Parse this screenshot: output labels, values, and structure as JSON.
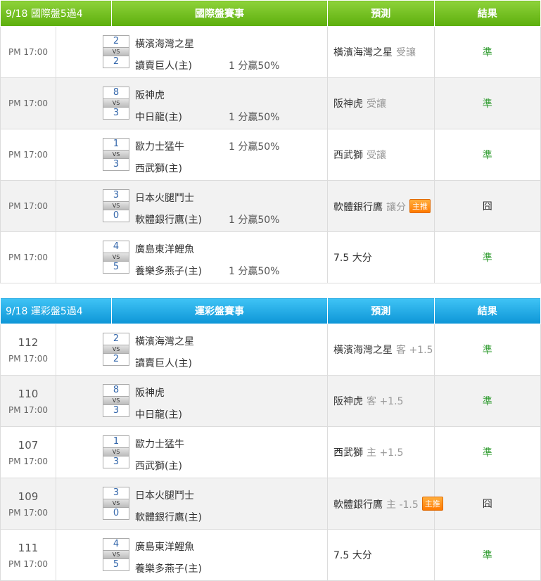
{
  "sections": [
    {
      "id": "intl",
      "title": "9/18 國際盤5過4",
      "headers": {
        "event": "國際盤賽事",
        "predict": "預測",
        "result": "結果"
      },
      "rows": [
        {
          "number": "",
          "time": "PM 17:00",
          "score_top": "2",
          "vs": "VS",
          "score_bot": "2",
          "team_top": "橫濱海灣之星",
          "team_bot": "讀賣巨人(主)",
          "odds": "1 分贏50%",
          "odds_on": "bot",
          "pred_team": "橫濱海灣之星",
          "pred_kind": "受讓",
          "badge": "",
          "result": "準"
        },
        {
          "number": "",
          "time": "PM 17:00",
          "score_top": "8",
          "vs": "VS",
          "score_bot": "3",
          "team_top": "阪神虎",
          "team_bot": "中日龍(主)",
          "odds": "1 分贏50%",
          "odds_on": "bot",
          "pred_team": "阪神虎",
          "pred_kind": "受讓",
          "badge": "",
          "result": "準"
        },
        {
          "number": "",
          "time": "PM 17:00",
          "score_top": "1",
          "vs": "VS",
          "score_bot": "3",
          "team_top": "歐力士猛牛",
          "team_bot": "西武獅(主)",
          "odds": "1 分贏50%",
          "odds_on": "top",
          "pred_team": "西武獅",
          "pred_kind": "受讓",
          "badge": "",
          "result": "準"
        },
        {
          "number": "",
          "time": "PM 17:00",
          "score_top": "3",
          "vs": "VS",
          "score_bot": "0",
          "team_top": "日本火腿鬥士",
          "team_bot": "軟體銀行鷹(主)",
          "odds": "1 分贏50%",
          "odds_on": "bot",
          "pred_team": "軟體銀行鷹",
          "pred_kind": "讓分",
          "badge": "主推",
          "result": "囧"
        },
        {
          "number": "",
          "time": "PM 17:00",
          "score_top": "4",
          "vs": "VS",
          "score_bot": "5",
          "team_top": "廣島東洋鯉魚",
          "team_bot": "養樂多燕子(主)",
          "odds": "1 分贏50%",
          "odds_on": "bot",
          "pred_team": "7.5 大分",
          "pred_kind": "",
          "badge": "",
          "result": "準"
        }
      ]
    },
    {
      "id": "lottery",
      "title": "9/18 運彩盤5過4",
      "headers": {
        "event": "運彩盤賽事",
        "predict": "預測",
        "result": "結果"
      },
      "rows": [
        {
          "number": "112",
          "time": "PM 17:00",
          "score_top": "2",
          "vs": "VS",
          "score_bot": "2",
          "team_top": "橫濱海灣之星",
          "team_bot": "讀賣巨人(主)",
          "odds": "",
          "odds_on": "",
          "pred_team": "橫濱海灣之星",
          "pred_kind": "客 +1.5",
          "badge": "",
          "result": "準"
        },
        {
          "number": "110",
          "time": "PM 17:00",
          "score_top": "8",
          "vs": "VS",
          "score_bot": "3",
          "team_top": "阪神虎",
          "team_bot": "中日龍(主)",
          "odds": "",
          "odds_on": "",
          "pred_team": "阪神虎",
          "pred_kind": "客 +1.5",
          "badge": "",
          "result": "準"
        },
        {
          "number": "107",
          "time": "PM 17:00",
          "score_top": "1",
          "vs": "VS",
          "score_bot": "3",
          "team_top": "歐力士猛牛",
          "team_bot": "西武獅(主)",
          "odds": "",
          "odds_on": "",
          "pred_team": "西武獅",
          "pred_kind": "主 +1.5",
          "badge": "",
          "result": "準"
        },
        {
          "number": "109",
          "time": "PM 17:00",
          "score_top": "3",
          "vs": "VS",
          "score_bot": "0",
          "team_top": "日本火腿鬥士",
          "team_bot": "軟體銀行鷹(主)",
          "odds": "",
          "odds_on": "",
          "pred_team": "軟體銀行鷹",
          "pred_kind": "主 -1.5",
          "badge": "主推",
          "result": "囧"
        },
        {
          "number": "111",
          "time": "PM 17:00",
          "score_top": "4",
          "vs": "VS",
          "score_bot": "5",
          "team_top": "廣島東洋鯉魚",
          "team_bot": "養樂多燕子(主)",
          "odds": "",
          "odds_on": "",
          "pred_team": "7.5 大分",
          "pred_kind": "",
          "badge": "",
          "result": "準"
        }
      ]
    }
  ]
}
